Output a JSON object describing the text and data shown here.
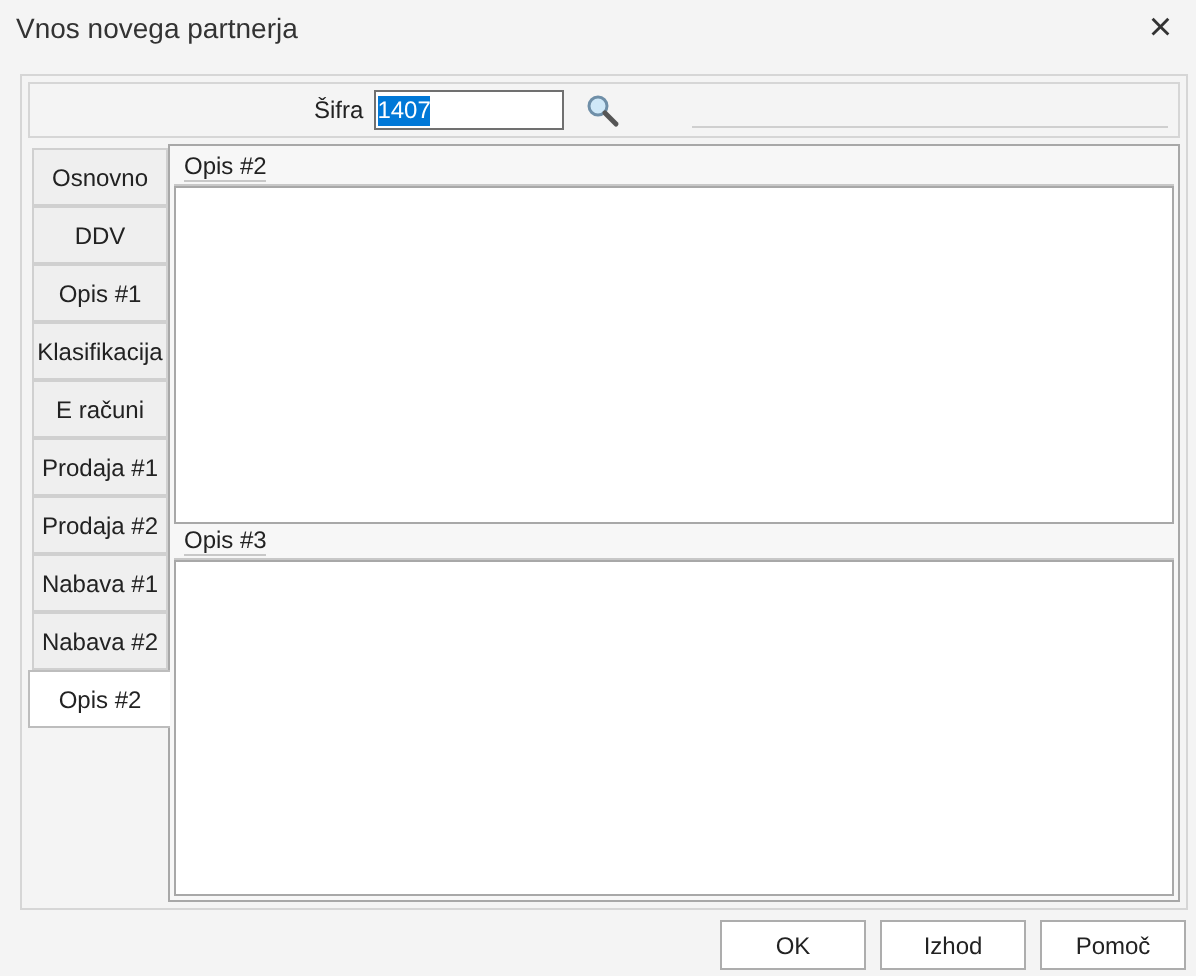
{
  "window": {
    "title": "Vnos novega partnerja",
    "close": "×"
  },
  "code_field": {
    "label": "Šifra",
    "value": "1407"
  },
  "tabs": [
    {
      "label": "Osnovno",
      "selected": false
    },
    {
      "label": "DDV",
      "selected": false
    },
    {
      "label": "Opis #1",
      "selected": false
    },
    {
      "label": "Klasifikacija",
      "selected": false
    },
    {
      "label": "E računi",
      "selected": false
    },
    {
      "label": "Prodaja #1",
      "selected": false
    },
    {
      "label": "Prodaja #2",
      "selected": false
    },
    {
      "label": "Nabava #1",
      "selected": false
    },
    {
      "label": "Nabava #2",
      "selected": false
    },
    {
      "label": "Opis #2",
      "selected": true
    }
  ],
  "sections": [
    {
      "title": "Opis #2"
    },
    {
      "title": "Opis #3"
    }
  ],
  "buttons": [
    "OK",
    "Izhod",
    "Pomoč"
  ]
}
